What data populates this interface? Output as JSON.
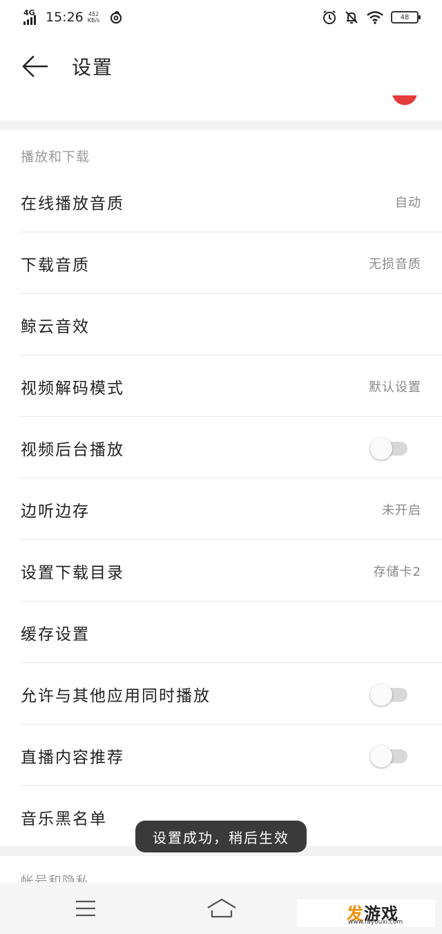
{
  "status_bar": {
    "network": "4G",
    "time": "15:26",
    "speed_value": "452",
    "speed_unit": "KB/s",
    "battery": "48",
    "icons": [
      "signal-icon",
      "netease-music-icon",
      "alarm-icon",
      "mute-bell-icon",
      "wifi-icon",
      "battery-icon"
    ]
  },
  "header": {
    "back_icon": "arrow-left-icon",
    "title": "设置"
  },
  "sections": [
    {
      "title": "播放和下载",
      "items": [
        {
          "label": "在线播放音质",
          "value": "自动"
        },
        {
          "label": "下载音质",
          "value": "无损音质"
        },
        {
          "label": "鲸云音效",
          "value": ""
        },
        {
          "label": "视频解码模式",
          "value": "默认设置"
        },
        {
          "label": "视频后台播放",
          "toggle": false
        },
        {
          "label": "边听边存",
          "value": "未开启"
        },
        {
          "label": "设置下载目录",
          "value": "存储卡2"
        },
        {
          "label": "缓存设置",
          "value": ""
        },
        {
          "label": "允许与其他应用同时播放",
          "toggle": false
        },
        {
          "label": "直播内容推荐",
          "toggle": false
        },
        {
          "label": "音乐黑名单",
          "value": ""
        }
      ]
    },
    {
      "title": "帐号和隐私"
    }
  ],
  "toast": "设置成功，稍后生效",
  "nav_bar": {
    "icons": [
      "menu-icon",
      "home-icon"
    ]
  },
  "watermark": {
    "logo_part1": "发",
    "logo_part2": "游戏",
    "url": "www.fayouxi.com"
  },
  "colors": {
    "accent_red": "#e63b3b",
    "toast_bg": "#3a3a3a",
    "section_gray": "#9a9a9a",
    "value_gray": "#888888",
    "watermark_orange": "#f08c00"
  }
}
